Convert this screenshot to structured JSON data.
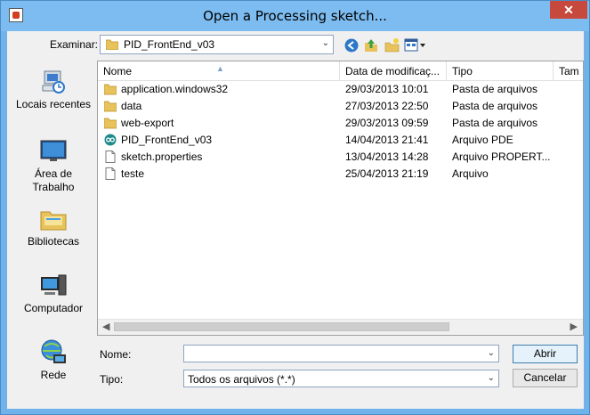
{
  "window": {
    "title": "Open a Processing sketch...",
    "close_glyph": "✕"
  },
  "lookin": {
    "label": "Examinar:",
    "value": "PID_FrontEnd_v03"
  },
  "toolbar": {
    "icons": [
      "back-icon",
      "up-folder-icon",
      "new-folder-icon",
      "view-menu-icon"
    ]
  },
  "places": [
    {
      "label": "Locais recentes",
      "icon": "recent-places-icon"
    },
    {
      "label": "Área de Trabalho",
      "icon": "desktop-icon"
    },
    {
      "label": "Bibliotecas",
      "icon": "libraries-icon"
    },
    {
      "label": "Computador",
      "icon": "computer-icon"
    },
    {
      "label": "Rede",
      "icon": "network-icon"
    }
  ],
  "columns": [
    "Nome",
    "Data de modificaç...",
    "Tipo",
    "Tam"
  ],
  "files": [
    {
      "name": "application.windows32",
      "date": "29/03/2013 10:01",
      "type": "Pasta de arquivos",
      "icon": "folder"
    },
    {
      "name": "data",
      "date": "27/03/2013 22:50",
      "type": "Pasta de arquivos",
      "icon": "folder"
    },
    {
      "name": "web-export",
      "date": "29/03/2013 09:59",
      "type": "Pasta de arquivos",
      "icon": "folder"
    },
    {
      "name": "PID_FrontEnd_v03",
      "date": "14/04/2013 21:41",
      "type": "Arquivo PDE",
      "icon": "pde"
    },
    {
      "name": "sketch.properties",
      "date": "13/04/2013 14:28",
      "type": "Arquivo PROPERT...",
      "icon": "file"
    },
    {
      "name": "teste",
      "date": "25/04/2013 21:19",
      "type": "Arquivo",
      "icon": "file"
    }
  ],
  "form": {
    "name_label": "Nome:",
    "name_value": "",
    "type_label": "Tipo:",
    "type_value": "Todos os arquivos (*.*)"
  },
  "buttons": {
    "open": "Abrir",
    "cancel": "Cancelar"
  },
  "colors": {
    "titlebar": "#7cbcf0",
    "close": "#c7483c",
    "folder": "#e8c25a"
  }
}
